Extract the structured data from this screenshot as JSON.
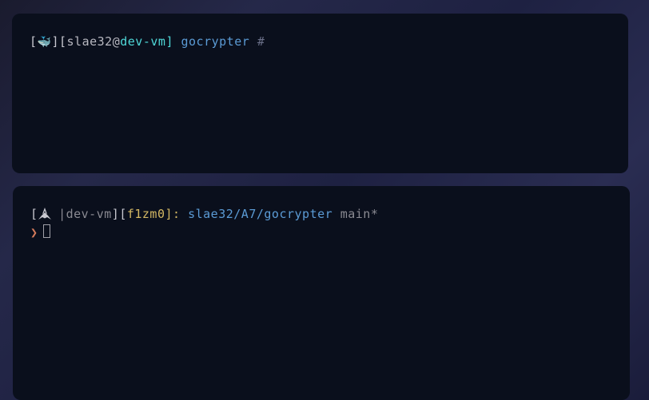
{
  "pane1": {
    "bracket_open": "[",
    "icon_name": "whale-icon",
    "whale_emoji": "🐳",
    "bracket_close1": "]",
    "bracket_open2": "[",
    "user": "slae32",
    "at": "@",
    "host": "dev-vm",
    "bracket_close2": "]",
    "dir": "gocrypter",
    "hash": "#"
  },
  "pane2": {
    "bracket_open": "[",
    "icon_name": "arch-icon",
    "pipe": "|",
    "host": "dev-vm",
    "bracket_close1": "]",
    "bracket_open2": "[",
    "user": "f1zm0",
    "bracket_close2": "]",
    "colon": ":",
    "path": "slae32/A7/gocrypter",
    "branch": "main",
    "asterisk": "*",
    "prompt_arrow": "❯"
  }
}
